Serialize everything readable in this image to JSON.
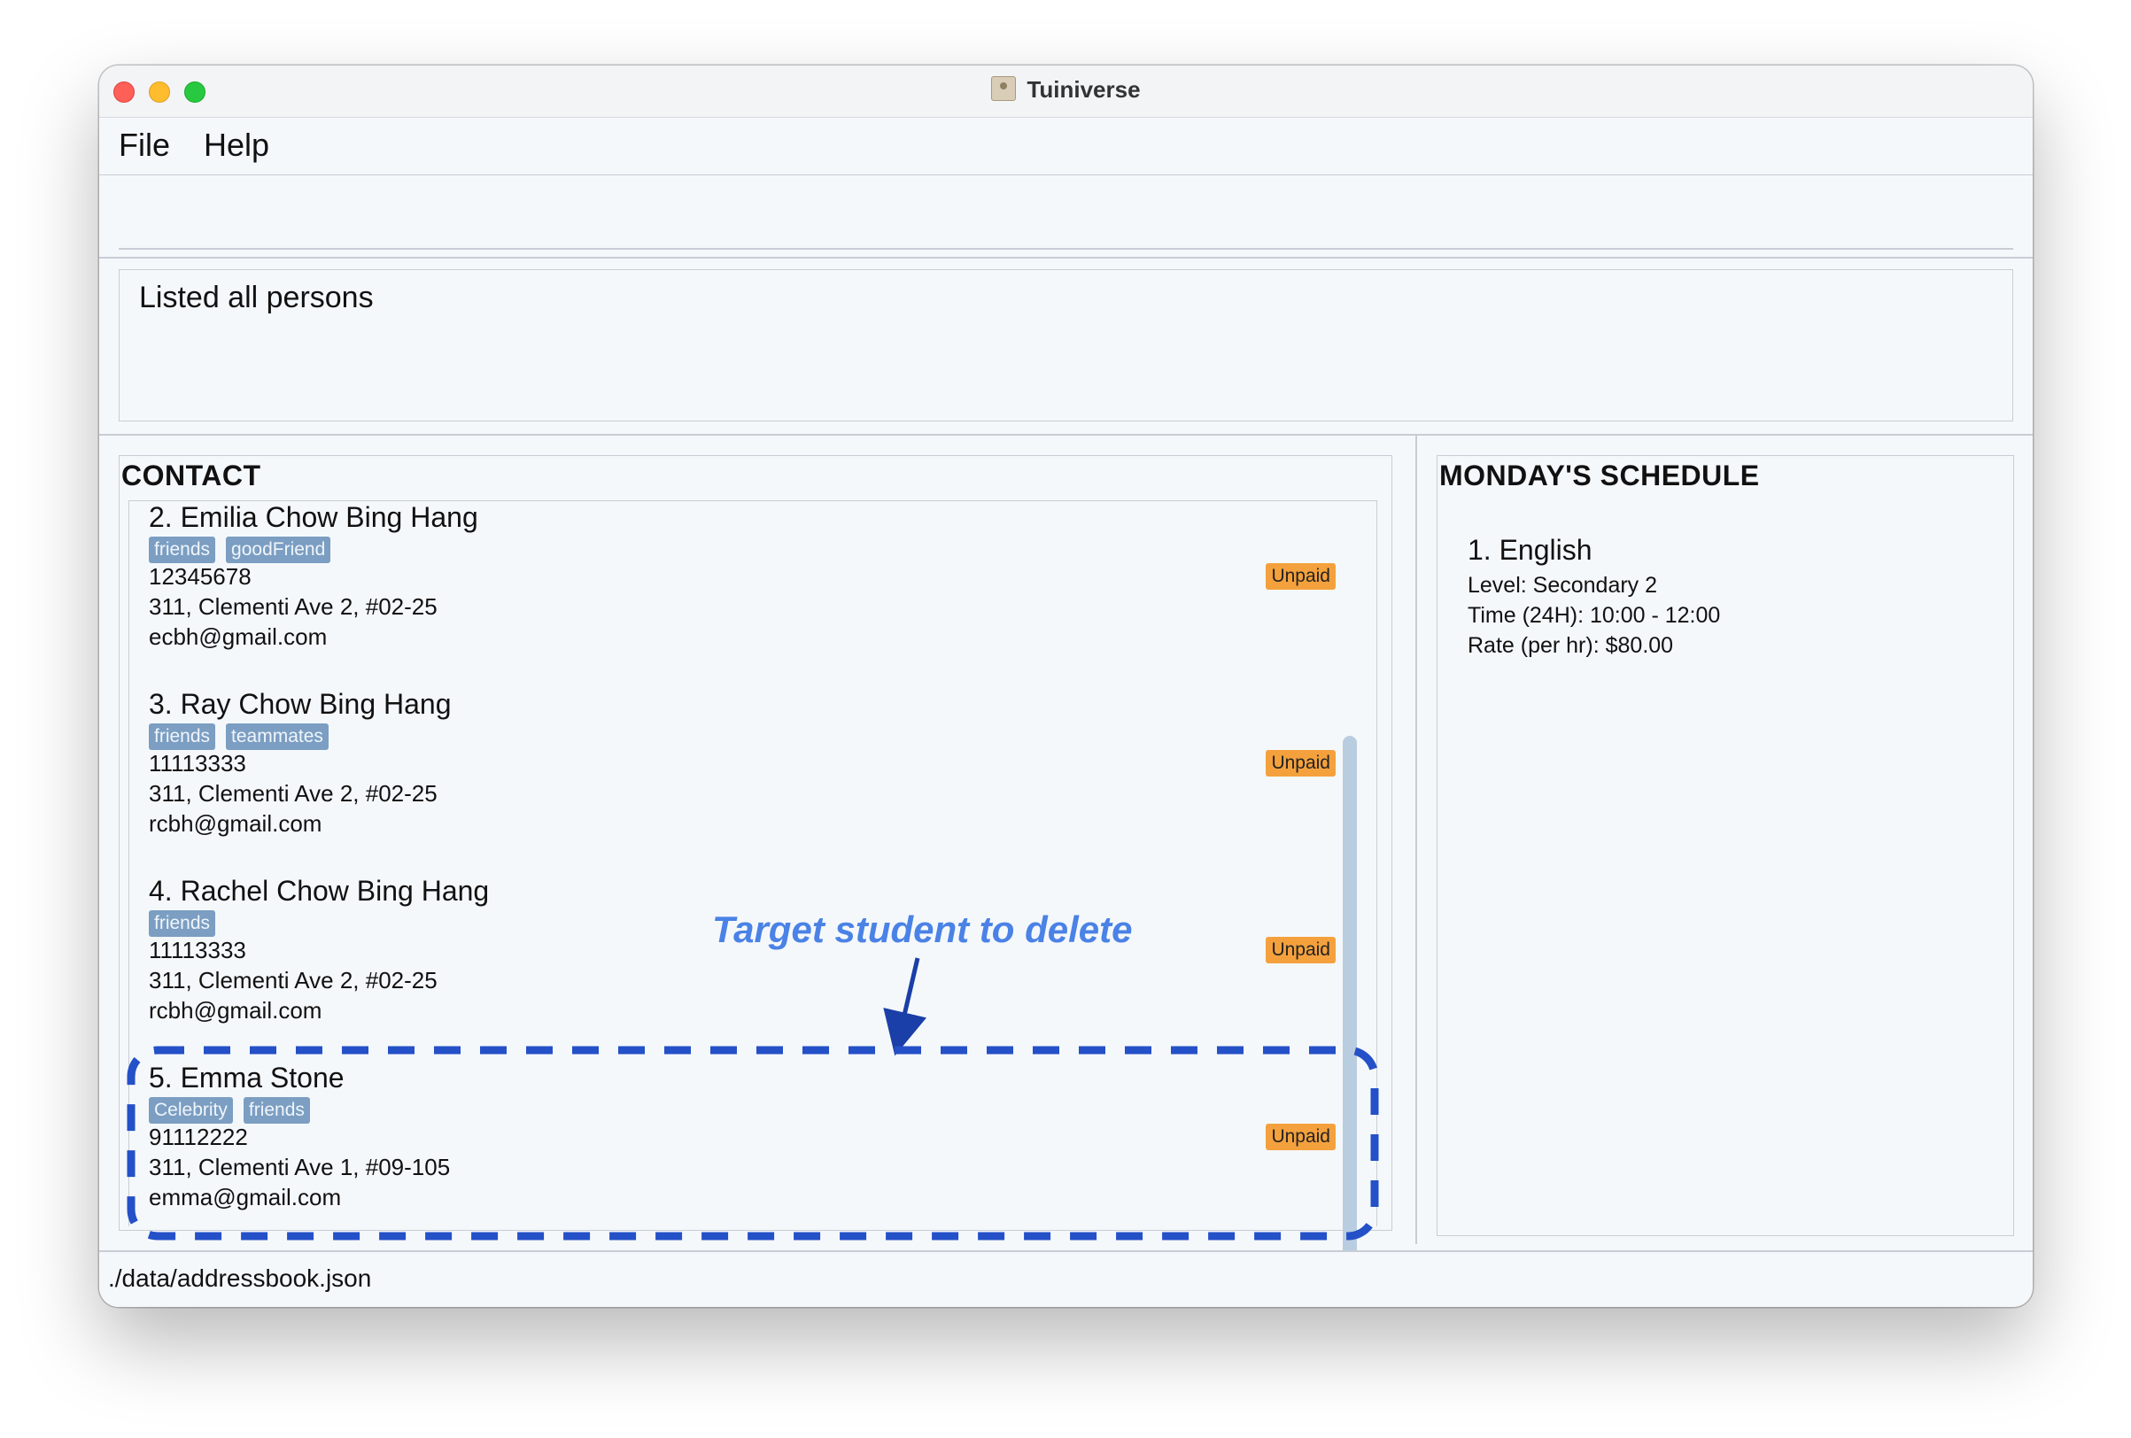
{
  "window": {
    "title": "Tuiniverse"
  },
  "menu": {
    "file": "File",
    "help": "Help"
  },
  "command": {
    "value": ""
  },
  "result": {
    "message": "Listed all persons"
  },
  "contacts": {
    "title": "CONTACT",
    "items": [
      {
        "name": "2. Emilia Chow Bing Hang",
        "tags": [
          "friends",
          "goodFriend"
        ],
        "phone": "12345678",
        "address": "311, Clementi Ave 2, #02-25",
        "email": "ecbh@gmail.com",
        "status": "Unpaid"
      },
      {
        "name": "3. Ray Chow Bing Hang",
        "tags": [
          "friends",
          "teammates"
        ],
        "phone": "11113333",
        "address": "311, Clementi Ave 2, #02-25",
        "email": "rcbh@gmail.com",
        "status": "Unpaid"
      },
      {
        "name": "4. Rachel Chow Bing Hang",
        "tags": [
          "friends"
        ],
        "phone": "11113333",
        "address": "311, Clementi Ave 2, #02-25",
        "email": "rcbh@gmail.com",
        "status": "Unpaid"
      },
      {
        "name": "5. Emma Stone",
        "tags": [
          "Celebrity",
          "friends"
        ],
        "phone": "91112222",
        "address": "311, Clementi Ave 1, #09-105",
        "email": "emma@gmail.com",
        "status": "Unpaid"
      }
    ]
  },
  "schedule": {
    "title": "MONDAY'S SCHEDULE",
    "items": [
      {
        "title": "1. English",
        "level": "Level: Secondary 2",
        "time": "Time (24H): 10:00 - 12:00",
        "rate": "Rate (per hr): $80.00"
      }
    ]
  },
  "status_bar": {
    "path": "./data/addressbook.json"
  },
  "annotation": {
    "text": "Target student to delete",
    "color": "#2450c8"
  },
  "colors": {
    "tag": "#7b9ec2",
    "badge": "#f4a13d",
    "background": "#f5f8fb"
  }
}
